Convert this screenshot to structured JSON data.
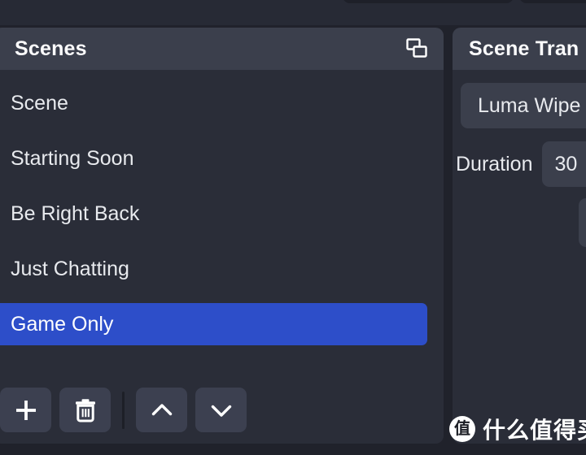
{
  "window": {
    "background_color": "#20222b"
  },
  "top_toolbar": {
    "chips": [
      "",
      ""
    ]
  },
  "scenes_panel": {
    "title": "Scenes",
    "header_icon": "duplicate-windows-icon",
    "selected_color": "#2d4ec9",
    "items": [
      {
        "label": "Scene",
        "selected": false
      },
      {
        "label": "Starting Soon",
        "selected": false
      },
      {
        "label": "Be Right Back",
        "selected": false
      },
      {
        "label": "Just Chatting",
        "selected": false
      },
      {
        "label": "Game Only",
        "selected": true
      }
    ],
    "toolbar": {
      "add": {
        "icon": "plus-icon",
        "label": "Add Scene"
      },
      "remove": {
        "icon": "trash-icon",
        "label": "Remove Scene"
      },
      "move_up": {
        "icon": "chevron-up-icon",
        "label": "Move Scene Up"
      },
      "move_down": {
        "icon": "chevron-down-icon",
        "label": "Move Scene Down"
      }
    }
  },
  "transitions_panel": {
    "title": "Scene Tran",
    "transition_value": "Luma Wipe",
    "duration_label": "Duration",
    "duration_value": "30",
    "stepper_icon": "stepper-icon"
  },
  "watermark": {
    "logo_glyph": "值",
    "text": "什么值得买"
  }
}
